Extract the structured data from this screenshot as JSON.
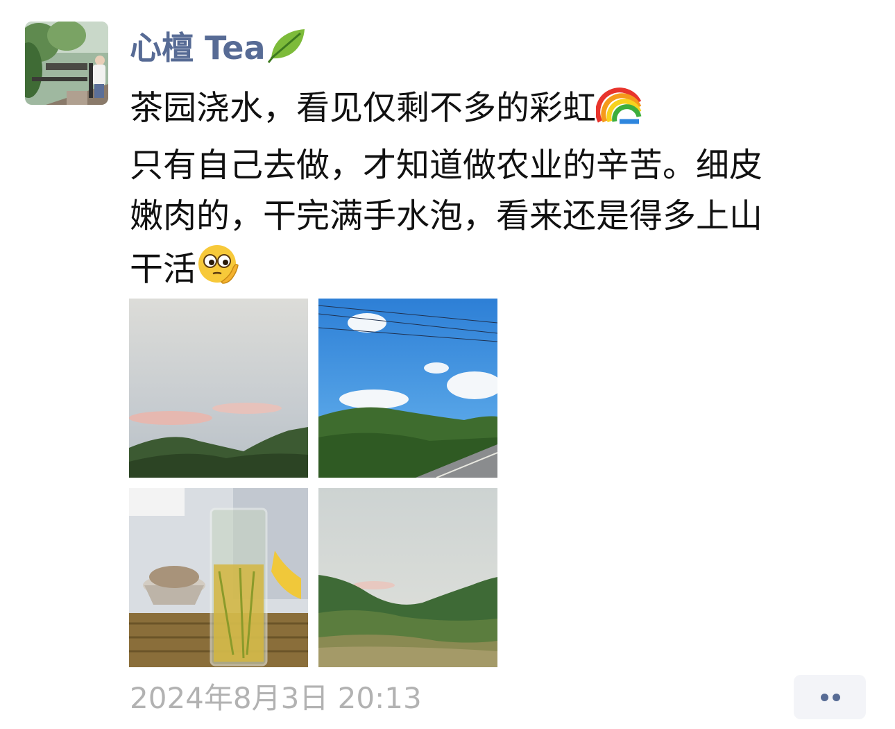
{
  "post": {
    "author": {
      "name": "心檀 Tea",
      "name_emoji": "leaf-icon",
      "avatar": "user-avatar-photo"
    },
    "content": {
      "line1": "茶园浇水，看见仅剩不多的彩虹",
      "line1_emoji": "rainbow-icon",
      "line2": "只有自己去做，才知道做农业的辛苦。细皮",
      "line3": "嫩肉的，干完满手水泡，看来还是得多上山",
      "line4": "干活",
      "line4_emoji": "thinking-face-icon"
    },
    "photos": [
      {
        "name": "cloudy-sky-mountain-photo"
      },
      {
        "name": "blue-sky-road-photo"
      },
      {
        "name": "tea-glass-photo"
      },
      {
        "name": "valley-field-photo"
      }
    ],
    "timestamp": "2024年8月3日 20:13",
    "more_button": "more-options-icon",
    "colors": {
      "author": "#576b95",
      "text": "#111111",
      "timestamp": "#b2b2b2",
      "button_bg": "#f3f4f8"
    }
  }
}
